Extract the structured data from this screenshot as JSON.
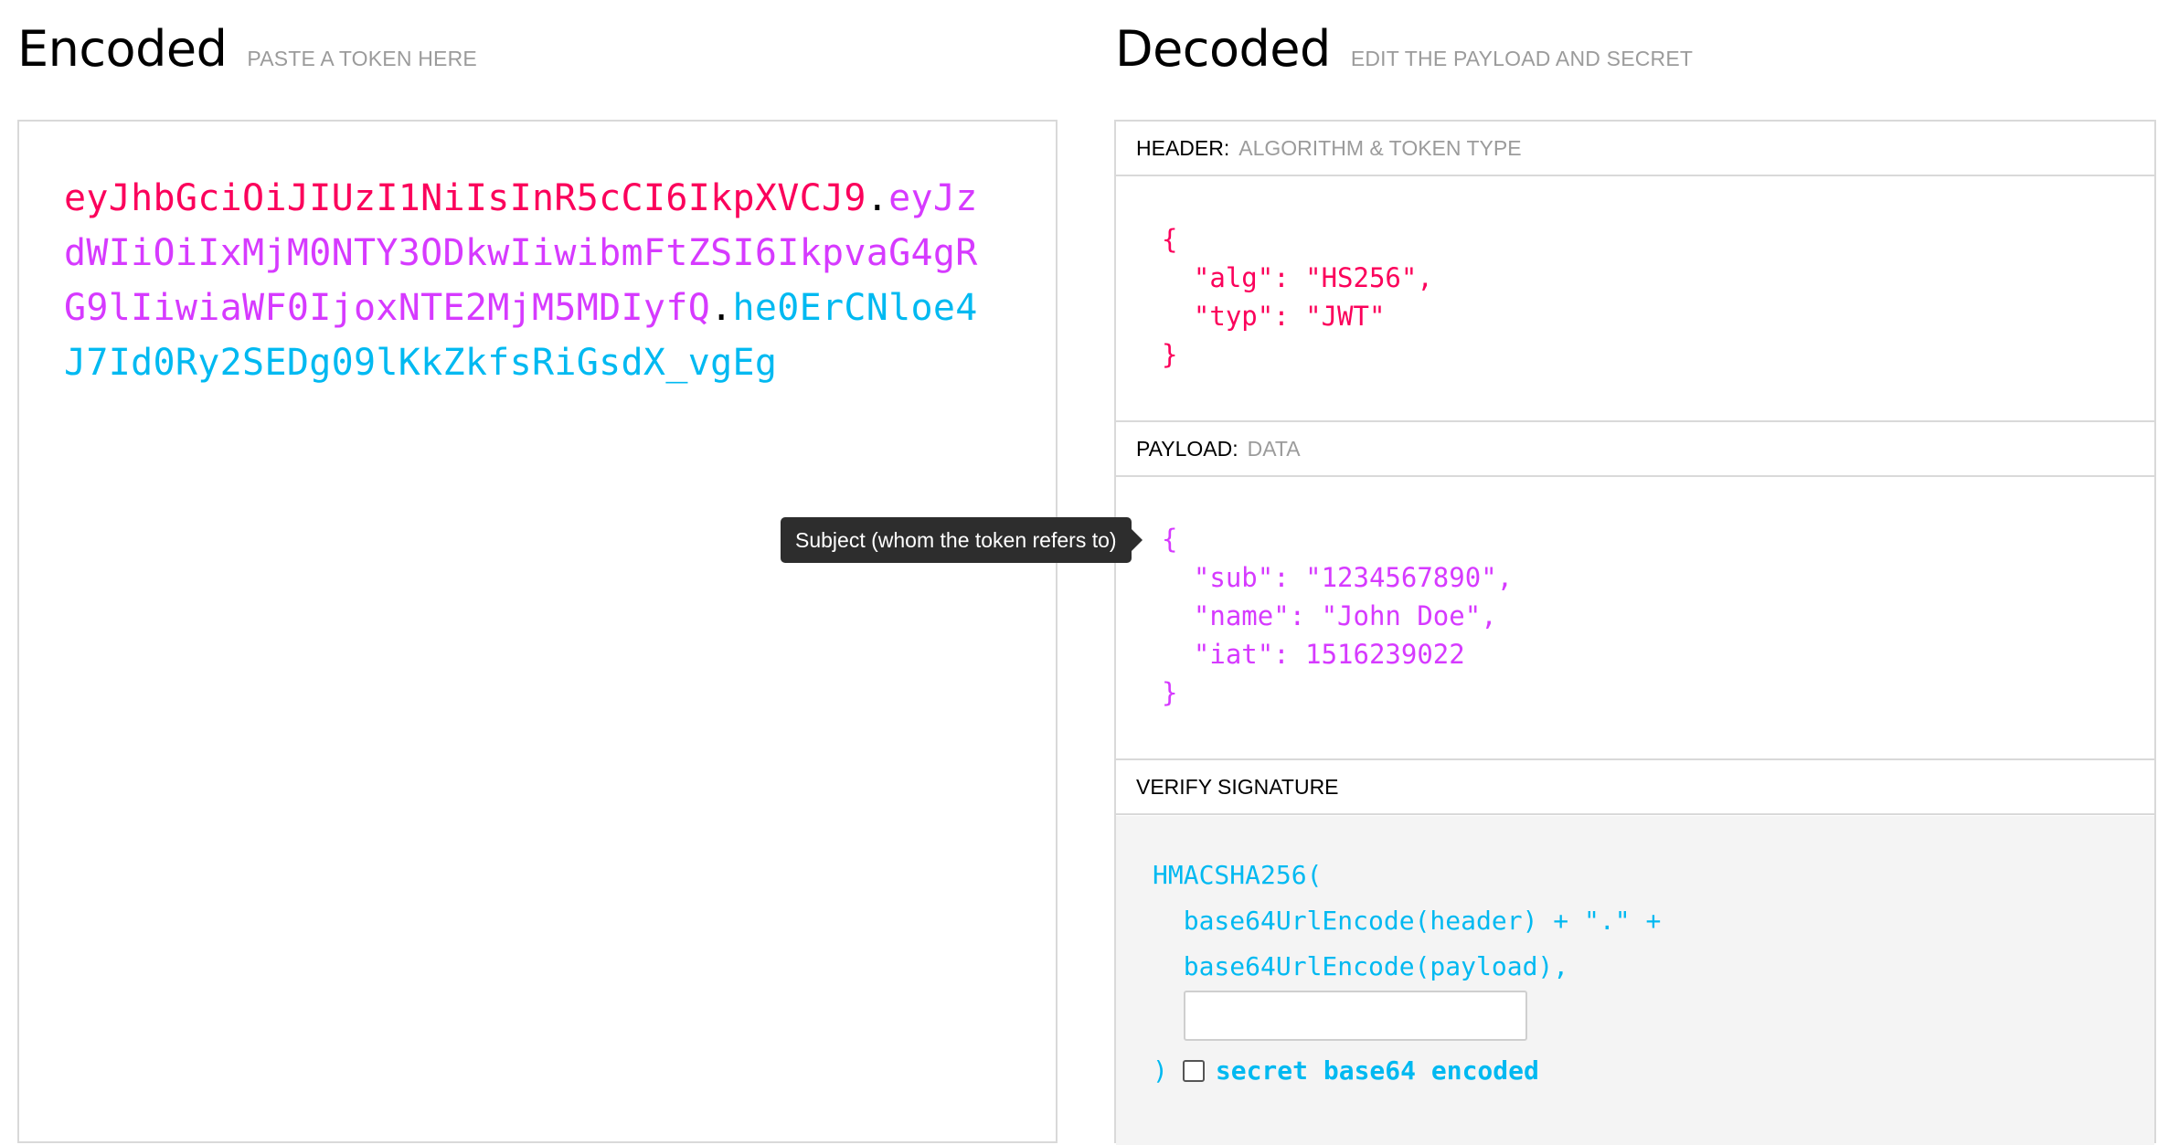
{
  "encoded": {
    "title": "Encoded",
    "hint": "PASTE A TOKEN HERE",
    "token": {
      "header_part": "eyJhbGciOiJIUzI1NiIsInR5cCI6IkpXVCJ9",
      "payload_part": "eyJzdWIiOiIxMjM0NTY3ODkwIiwibmFtZSI6IkpvaG4gRG9lIiwiaWF0IjoxNTE2MjM5MDIyfQ",
      "signature_part": "he0ErCNloe4J7Id0Ry2SEDg09lKkZkfsRiGsdX_vgEg",
      "dot": "."
    }
  },
  "decoded": {
    "title": "Decoded",
    "hint": "EDIT THE PAYLOAD AND SECRET",
    "header_panel": {
      "label": "HEADER:",
      "sub": "ALGORITHM & TOKEN TYPE",
      "json_text": "{\n  \"alg\": \"HS256\",\n  \"typ\": \"JWT\"\n}"
    },
    "payload_panel": {
      "label": "PAYLOAD:",
      "sub": "DATA",
      "json_text": "{\n  \"sub\": \"1234567890\",\n  \"name\": \"John Doe\",\n  \"iat\": 1516239022\n}"
    },
    "verify_panel": {
      "label": "VERIFY SIGNATURE",
      "code_text": "HMACSHA256(\n  base64UrlEncode(header) + \".\" +\n  base64UrlEncode(payload),",
      "secret_value": "",
      "close_paren": ")",
      "checkbox_label": "secret base64 encoded",
      "checkbox_checked": false
    }
  },
  "tooltip": {
    "text": "Subject (whom the token refers to)"
  },
  "colors": {
    "header": "#fb015b",
    "payload": "#d63aff",
    "signature": "#00b9f1",
    "tooltip_bg": "#2d2d2d"
  }
}
